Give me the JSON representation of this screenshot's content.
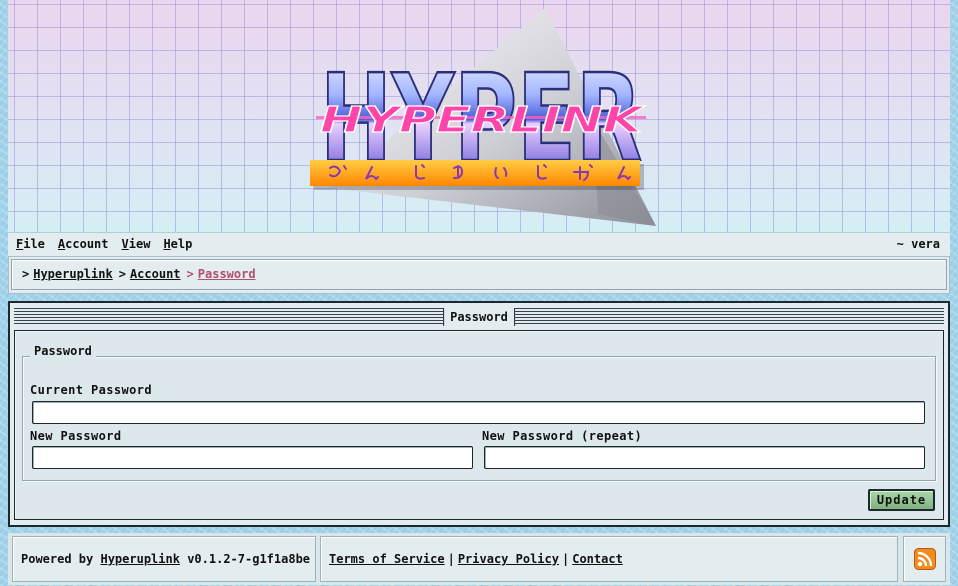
{
  "header": {
    "logo": {
      "wordmark": "HYPER",
      "overlay": "HYPERLINK",
      "subtitle_kana": "ぶんじゆいじぱん"
    }
  },
  "menu": {
    "items": [
      {
        "label": "File"
      },
      {
        "label": "Account"
      },
      {
        "label": "View"
      },
      {
        "label": "Help"
      }
    ],
    "user": "~ vera"
  },
  "breadcrumb": {
    "separator": ">",
    "items": [
      {
        "label": "Hyperuplink"
      },
      {
        "label": "Account"
      },
      {
        "label": "Password",
        "current": true
      }
    ]
  },
  "panel": {
    "title": "Password",
    "fieldset_legend": "Password",
    "current_password": {
      "label": "Current Password"
    },
    "new_password": {
      "label": "New Password"
    },
    "new_password_repeat": {
      "label": "New Password (repeat)"
    },
    "submit_label": "Update"
  },
  "footer": {
    "powered_by": "Powered by",
    "app_link": "Hyperuplink",
    "version": "v0.1.2-7-g1f1a8be",
    "separator": "|",
    "links": [
      {
        "label": "Terms of Service"
      },
      {
        "label": "Privacy Policy"
      },
      {
        "label": "Contact"
      }
    ],
    "feed_icon": "rss-icon"
  },
  "colors": {
    "page_background": "#a3d3ea",
    "panel": "#e3ecef",
    "frame": "#1c282d",
    "breadcrumb_current": "#b04f6f",
    "button": "#8fc08f",
    "rss": "#f28a1e"
  }
}
